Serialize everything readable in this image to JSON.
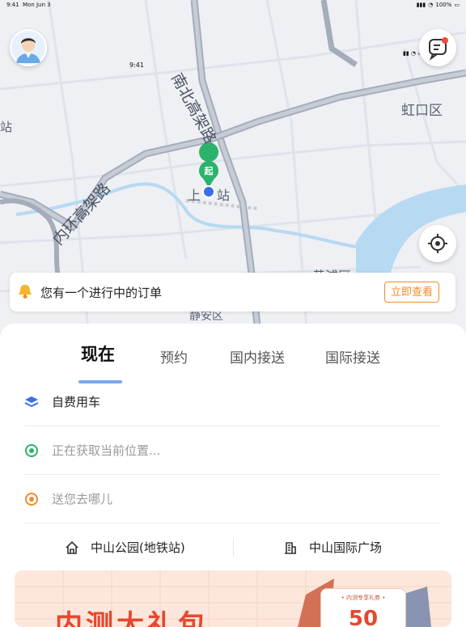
{
  "status_bar": {
    "time": "9:41",
    "date": "Mon Jun 3",
    "battery": "100%"
  },
  "map_status": {
    "time": "9:41"
  },
  "map": {
    "road_ns": "南北高架路",
    "road_ring": "内环高架路",
    "district_hongkou": "虹口区",
    "district_huangpu": "黄浦区",
    "district_jingan": "静安区",
    "edge_label": "站",
    "station_left": "上",
    "station_right": "站",
    "start_marker": "起"
  },
  "order": {
    "text": "您有一个进行中的订单",
    "button": "立即查看"
  },
  "tabs": [
    "现在",
    "预约",
    "国内接送",
    "国际接送"
  ],
  "rows": {
    "type": "自费用车",
    "origin_placeholder": "正在获取当前位置...",
    "destination_placeholder": "送您去哪儿"
  },
  "quick": {
    "left": "中山公园(地铁站)",
    "right": "中山国际广场"
  },
  "banner": {
    "big_text": "内测大礼包",
    "coupon_title": "• 内测专享礼券 •",
    "coupon_value": "50"
  },
  "colors": {
    "accent_blue": "#3b6fe8",
    "green": "#2bb36b",
    "orange": "#f08c2a",
    "water": "#b7d9f2"
  },
  "icons": {
    "bell": "bell-icon",
    "layers": "layers-icon",
    "origin": "origin-dot-icon",
    "destination": "destination-dot-icon",
    "home": "home-icon",
    "building": "building-icon",
    "chat": "chat-icon",
    "locate": "locate-icon"
  }
}
